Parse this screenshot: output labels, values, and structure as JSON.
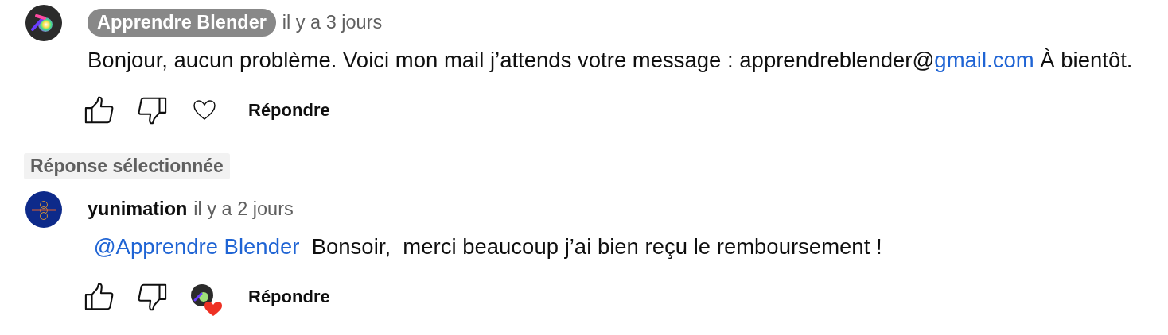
{
  "comments": [
    {
      "author": "Apprendre Blender",
      "author_is_creator": true,
      "time": "il y a 3 jours",
      "avatar": {
        "kind": "blender"
      },
      "body": [
        {
          "text": "Bonjour, aucun problème. Voici mon mail j’attends votre message : apprendreblender@",
          "link": false
        },
        {
          "text": "gmail.com",
          "link": true
        },
        {
          "text": " À bientôt.",
          "link": false
        }
      ],
      "hearted": false,
      "reply": "Répondre"
    },
    {
      "author": "yunimation",
      "author_is_creator": false,
      "time": "il y a 2 jours",
      "avatar": {
        "kind": "rings"
      },
      "label": "Réponse sélectionnée",
      "body": [
        {
          "text": " @Apprendre Blender",
          "link": true
        },
        {
          "text": "  Bonsoir,  merci beaucoup j’ai bien reçu le remboursement !",
          "link": false
        }
      ],
      "hearted": true,
      "reply": "Répondre"
    }
  ]
}
